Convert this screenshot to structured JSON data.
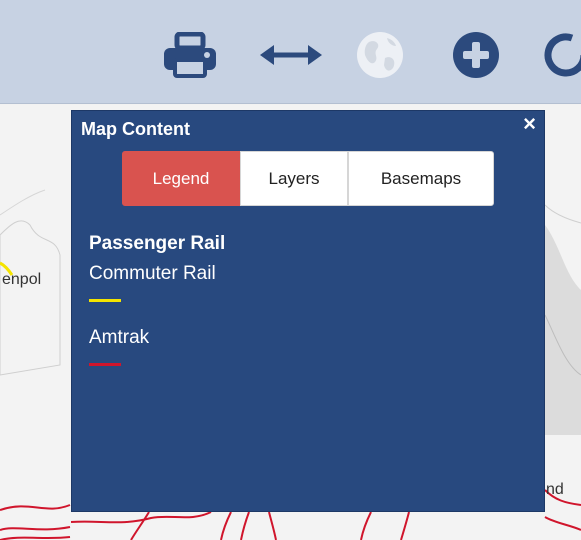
{
  "toolbar": {
    "icons": [
      "print-icon",
      "measure-icon",
      "globe-icon",
      "zoom-in-icon",
      "refresh-icon"
    ]
  },
  "map": {
    "labels": [
      "enpol",
      "nd"
    ]
  },
  "panel": {
    "title": "Map Content",
    "close_label": "×",
    "tabs": [
      {
        "label": "Legend",
        "active": true
      },
      {
        "label": "Layers",
        "active": false
      },
      {
        "label": "Basemaps",
        "active": false
      }
    ],
    "legend": {
      "heading": "Passenger Rail",
      "items": [
        {
          "label": "Commuter Rail",
          "color": "#f5e400"
        },
        {
          "label": "Amtrak",
          "color": "#d0152c"
        }
      ]
    }
  },
  "colors": {
    "toolbar_bg": "#c7d2e3",
    "icon_color": "#2c4a7d",
    "panel_bg": "#28497f",
    "active_tab": "#d9534f"
  }
}
